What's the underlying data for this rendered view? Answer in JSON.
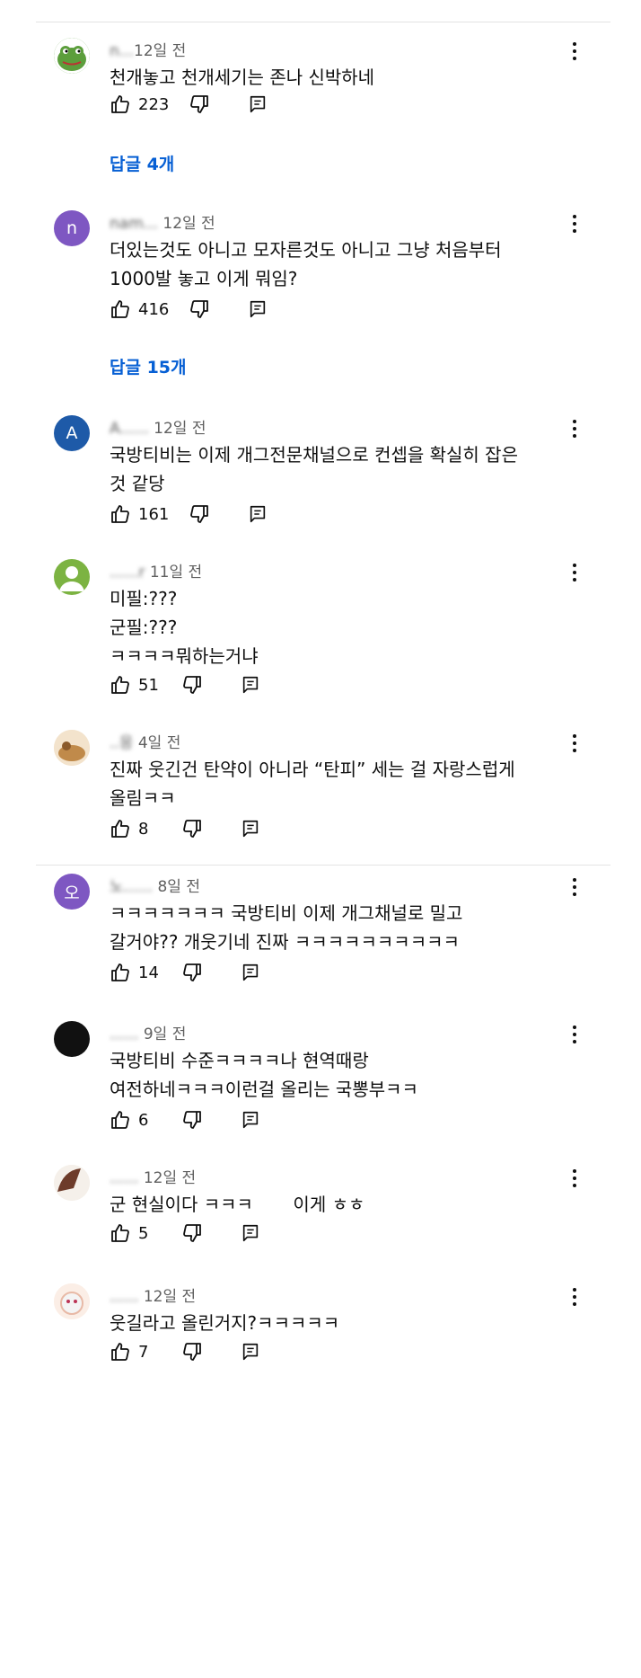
{
  "comments": [
    {
      "author": "n...",
      "time": "12일 전",
      "avatar_letter": "",
      "avatar_color": "#6aa84f",
      "lines": [
        "천개놓고 천개세기는 존나 신박하네"
      ],
      "likes": "223",
      "replies": "답글 4개"
    },
    {
      "author": "nam...",
      "time": "12일 전",
      "avatar_letter": "n",
      "avatar_color": "#7e57c2",
      "lines": [
        "더있는것도 아니고 모자른것도 아니고 그냥 처음부터",
        "1000발 놓고 이게 뭐임?"
      ],
      "likes": "416",
      "replies": "답글 15개"
    },
    {
      "author": "A......",
      "time": "12일 전",
      "avatar_letter": "A",
      "avatar_color": "#1e5aa8",
      "lines": [
        "국방티비는 이제 개그전문채널으로 컨셉을 확실히 잡은",
        "것 같당"
      ],
      "likes": "161"
    },
    {
      "author": "......r",
      "time": "11일 전",
      "avatar_letter": "",
      "avatar_color": "#7cb342",
      "lines": [
        "미필:???",
        "군필:???",
        "ㅋㅋㅋㅋ뭐하는거냐"
      ],
      "likes": "51"
    },
    {
      "author": "..응",
      "time": "4일 전",
      "avatar_letter": "",
      "avatar_color": "#c08a4a",
      "lines": [
        "진짜 웃긴건 탄약이 아니라 “탄피” 세는 걸 자랑스럽게",
        "올림ㅋㅋ"
      ],
      "likes": "8"
    },
    {
      "author": "노......",
      "time": "8일 전",
      "avatar_letter": "오",
      "avatar_color": "#7e57c2",
      "lines": [
        "ㅋㅋㅋㅋㅋㅋㅋ 국방티비 이제 개그채널로 밀고",
        "갈거야?? 개웃기네 진짜 ㅋㅋㅋㅋㅋㅋㅋㅋㅋㅋ"
      ],
      "likes": "14"
    },
    {
      "author": "......",
      "time": "9일 전",
      "avatar_letter": "",
      "avatar_color": "#111111",
      "lines": [
        "국방티비 수준ㅋㅋㅋㅋ나 현역때랑",
        "여전하네ㅋㅋㅋ이런걸 올리는 국뽕부ㅋㅋ"
      ],
      "likes": "6"
    },
    {
      "author": "......",
      "time": "12일 전",
      "avatar_letter": "",
      "avatar_color": "#6d3b2a",
      "lines": [
        "군 현실이다 ㅋㅋㅋ       이게 ㅎㅎ"
      ],
      "likes": "5"
    },
    {
      "author": "......",
      "time": "12일 전",
      "avatar_letter": "",
      "avatar_color": "#e8b9a6",
      "lines": [
        "웃길라고 올린거지?ㅋㅋㅋㅋㅋ"
      ],
      "likes": "7"
    }
  ]
}
